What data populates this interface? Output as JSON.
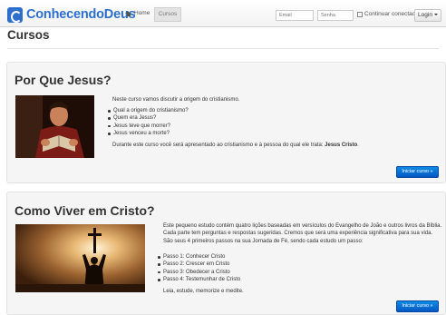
{
  "navbar": {
    "brand": "ConhecendoDeus",
    "home_label": "Home",
    "active_label": "Cursos",
    "email_placeholder": "Email",
    "password_placeholder": "Senha",
    "remember_label": "Continuar conectado",
    "login_label": "Login"
  },
  "page": {
    "title": "Cursos"
  },
  "courses": [
    {
      "title": "Por Que Jesus?",
      "intro": "Neste curso vamos discutir a origem do cristianismo.",
      "bullets": [
        "Qual a origem do cristianismo?",
        "Quem era Jesus?",
        "Jesus teve que morrer?",
        "Jesus venceu a morte?"
      ],
      "outro": "Durante este curso você será apresentado ao cristianismo e à pessoa do qual ele trata:",
      "outro_bold": "Jesus Cristo",
      "outro_end": ".",
      "cta": "Iniciar curso »"
    },
    {
      "title": "Como Viver em Cristo?",
      "intro": "Este pequeno estudo contém quatro lições baseadas em versículos do Evangelho de João e outros livros da Bíblia. Cada parte tem perguntas e respostas sugeridas. Cremos que será uma experiência significativa para sua vida. São seus 4 primeiros passos na sua Jornada de Fé, sendo cada estudo um passo:",
      "bullets": [
        "Passo 1: Conhecer Cristo",
        "Passo 2: Crescer em Cristo",
        "Passo 3: Obedecer a Cristo",
        "Passo 4: Testemunhar de Cristo"
      ],
      "outro": "Leia, estude, memorize e medite.",
      "cta": "Iniciar curso »"
    }
  ]
}
